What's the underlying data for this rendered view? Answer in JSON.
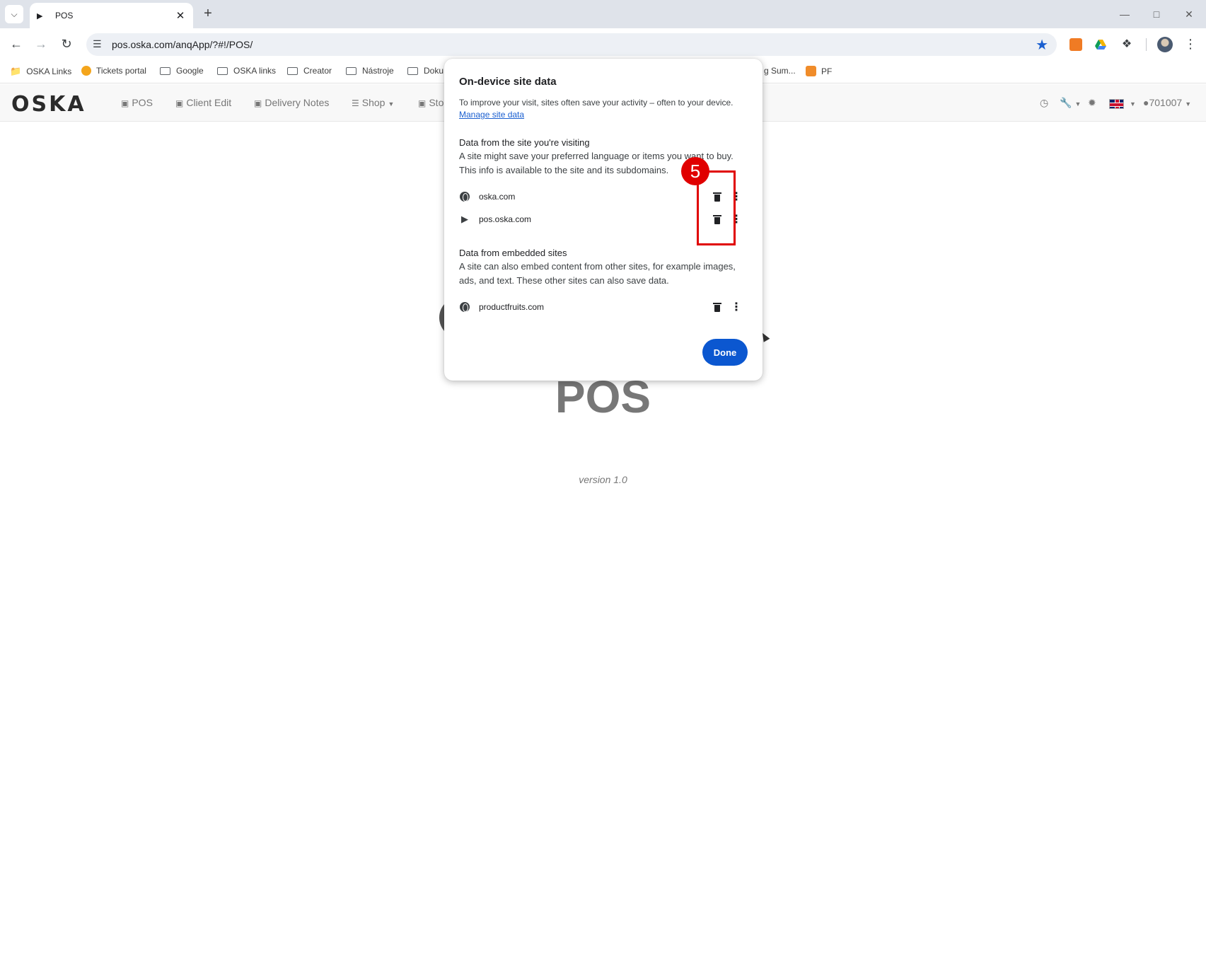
{
  "browser": {
    "tab": {
      "title": "POS"
    },
    "address_bar": {
      "url": "pos.oska.com/anqApp/?#!/POS/"
    },
    "bookmarks": [
      {
        "label": "OSKA Links",
        "icon": "managed-bookmarks-icon"
      },
      {
        "label": "Tickets portal",
        "icon": "tickets-icon"
      },
      {
        "label": "Google",
        "icon": "folder-icon"
      },
      {
        "label": "OSKA links",
        "icon": "folder-icon"
      },
      {
        "label": "Creator",
        "icon": "folder-icon"
      },
      {
        "label": "Nástroje",
        "icon": "folder-icon"
      },
      {
        "label": "Doku",
        "icon": "folder-icon"
      },
      {
        "label": "g Sum...",
        "icon": ""
      },
      {
        "label": "PF",
        "icon": "pf-icon"
      }
    ]
  },
  "site_nav": {
    "logo": "OSKA",
    "items": [
      {
        "label": "POS",
        "icon": "shopping-bag-icon"
      },
      {
        "label": "Client Edit",
        "icon": "contact-card-icon"
      },
      {
        "label": "Delivery Notes",
        "icon": "archive-icon"
      },
      {
        "label": "Shop",
        "icon": "sliders-icon"
      },
      {
        "label": "Sto",
        "icon": "archive-icon"
      }
    ],
    "user_id": "701007"
  },
  "page": {
    "title": "POS",
    "version": "version 1.0"
  },
  "dialog": {
    "title": "On-device site data",
    "intro": "To improve your visit, sites often save your activity – often to your device.",
    "manage_link": "Manage site data",
    "visiting_section": {
      "heading": "Data from the site you're visiting",
      "line1": "A site might save your preferred language or items you want to buy.",
      "line2": "This info is available to the site and its subdomains.",
      "sites": [
        {
          "name": "oska.com",
          "icon": "globe-icon"
        },
        {
          "name": "pos.oska.com",
          "icon": "expand-arrow-icon"
        }
      ]
    },
    "embedded_section": {
      "heading": "Data from embedded sites",
      "body": "A site can also embed content from other sites, for example images, ads, and text. These other sites can also save data.",
      "sites": [
        {
          "name": "productfruits.com",
          "icon": "globe-icon"
        }
      ]
    },
    "done_label": "Done"
  },
  "annotation": {
    "step_number": "5",
    "color": "#e00000"
  }
}
